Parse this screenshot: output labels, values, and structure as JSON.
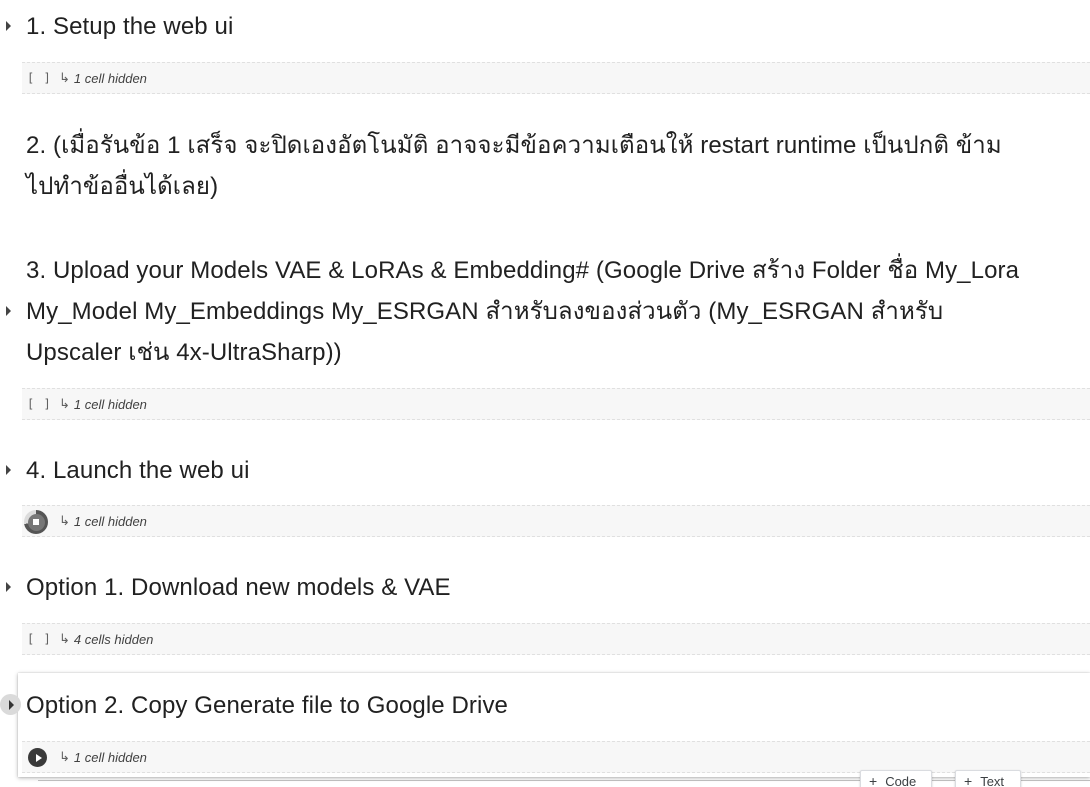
{
  "sections": [
    {
      "title": "1. Setup the web ui",
      "hidden_label": "1 cell hidden",
      "run_state": "idle",
      "brackets": "[ ]"
    },
    {
      "title": "2. (เมื่อรันข้อ 1 เสร็จ จะปิดเองอัตโนมัติ อาจจะมีข้อความเตือนให้ restart runtime เป็นปกติ ข้าม ไปทำข้ออื่นได้เลย)"
    },
    {
      "title": "3. Upload your Models VAE & LoRAs & Embedding# (Google Drive สร้าง Folder ชื่อ My_Lora My_Model My_Embeddings My_ESRGAN สำหรับลงของส่วนตัว (My_ESRGAN สำหรับ Upscaler เช่น 4x-UltraSharp))",
      "hidden_label": "1 cell hidden",
      "run_state": "idle",
      "brackets": "[ ]"
    },
    {
      "title": "4. Launch the web ui",
      "hidden_label": "1 cell hidden",
      "run_state": "running"
    },
    {
      "title": "Option 1. Download new models & VAE",
      "hidden_label": "4 cells hidden",
      "run_state": "idle",
      "brackets": "[ ]"
    },
    {
      "title": "Option 2. Copy Generate file to Google Drive",
      "hidden_label": "1 cell hidden",
      "run_state": "play"
    }
  ],
  "add_cell": {
    "code_label": "Code",
    "text_label": "Text",
    "plus": "+"
  },
  "icons": {
    "return": "↳"
  }
}
